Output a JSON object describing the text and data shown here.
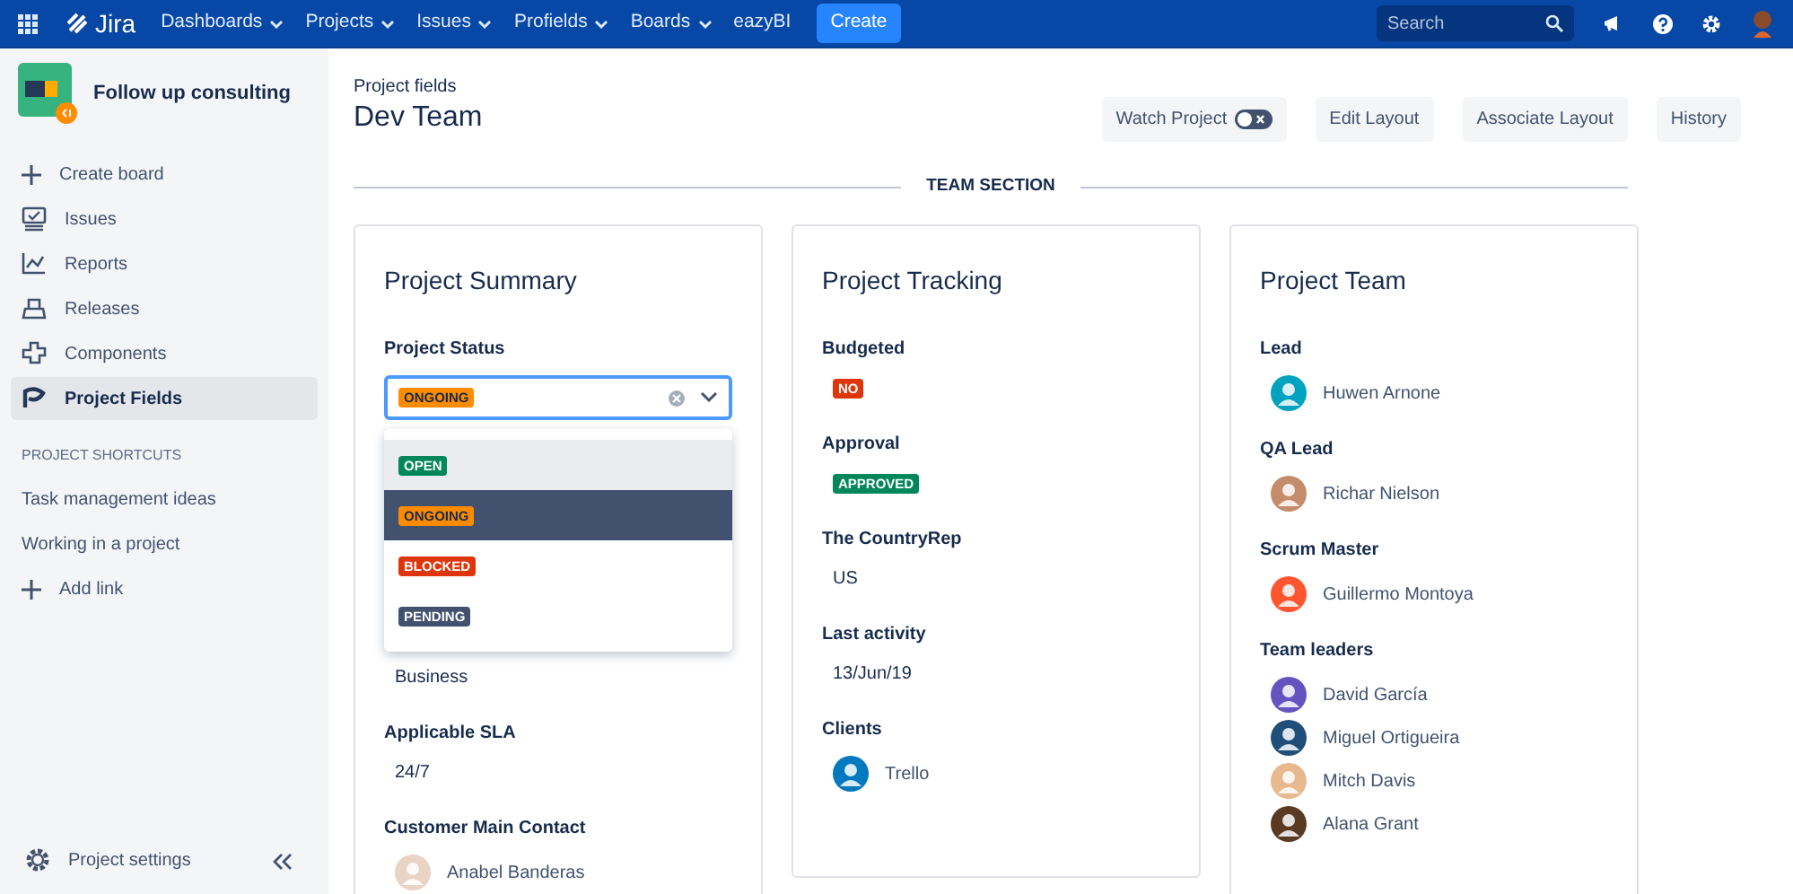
{
  "topnav": {
    "menus": [
      {
        "label": "Dashboards",
        "caret": true
      },
      {
        "label": "Projects",
        "caret": true
      },
      {
        "label": "Issues",
        "caret": true
      },
      {
        "label": "Profields",
        "caret": true
      },
      {
        "label": "Boards",
        "caret": true
      },
      {
        "label": "eazyBI",
        "caret": false
      }
    ],
    "logo": "Jira",
    "create": "Create",
    "search": {
      "placeholder": "Search"
    }
  },
  "sidebar": {
    "project": "Follow up consulting",
    "create_board": "Create board",
    "items": [
      {
        "label": "Issues",
        "selected": false
      },
      {
        "label": "Reports",
        "selected": false
      },
      {
        "label": "Releases",
        "selected": false
      },
      {
        "label": "Components",
        "selected": false
      },
      {
        "label": "Project Fields",
        "selected": true
      }
    ],
    "shortcuts_heading": "PROJECT SHORTCUTS",
    "shortcuts": [
      "Task management ideas",
      "Working in a project"
    ],
    "add_link": "Add link",
    "settings": "Project settings"
  },
  "header": {
    "breadcrumb": "Project fields",
    "title": "Dev Team",
    "watch": {
      "label": "Watch Project",
      "on": false
    },
    "buttons": [
      "Edit Layout",
      "Associate Layout",
      "History"
    ]
  },
  "section_title": "TEAM SECTION",
  "cards": [
    {
      "title": "Project Summary",
      "fields": [
        {
          "kind": "select",
          "label": "Project Status",
          "value": {
            "label": "ONGOING",
            "color": "#ff8b00"
          },
          "options": [
            {
              "label": "OPEN",
              "color": "#00875a",
              "selected": false,
              "hovered": true
            },
            {
              "label": "ONGOING",
              "color": "#ff8b00",
              "selected": true,
              "hovered": false
            },
            {
              "label": "BLOCKED",
              "color": "#de350b",
              "selected": false,
              "hovered": false
            },
            {
              "label": "PENDING",
              "color": "#42526e",
              "selected": false,
              "hovered": false
            }
          ]
        },
        {
          "kind": "text",
          "value": "Business"
        },
        {
          "kind": "text",
          "label": "Applicable SLA",
          "value": "24/7"
        },
        {
          "kind": "users",
          "label": "Customer Main Contact",
          "users": [
            {
              "name": "Anabel Banderas",
              "color": "#e9d3c4"
            }
          ]
        }
      ]
    },
    {
      "title": "Project Tracking",
      "fields": [
        {
          "kind": "lozenge",
          "label": "Budgeted",
          "value": {
            "label": "NO",
            "color": "#de350b"
          }
        },
        {
          "kind": "lozenge",
          "label": "Approval",
          "value": {
            "label": "APPROVED",
            "color": "#00875a"
          }
        },
        {
          "kind": "text",
          "label": "The CountryRep",
          "value": "US"
        },
        {
          "kind": "text",
          "label": "Last activity",
          "value": "13/Jun/19"
        },
        {
          "kind": "users",
          "label": "Clients",
          "users": [
            {
              "name": "Trello",
              "color": "#0079bf"
            }
          ]
        }
      ]
    },
    {
      "title": "Project Team",
      "fields": [
        {
          "kind": "users",
          "label": "Lead",
          "users": [
            {
              "name": "Huwen Arnone",
              "color": "#00a3bf"
            }
          ]
        },
        {
          "kind": "users",
          "label": "QA Lead",
          "users": [
            {
              "name": "Richar Nielson",
              "color": "#c58c6b"
            }
          ]
        },
        {
          "kind": "users",
          "label": "Scrum Master",
          "users": [
            {
              "name": "Guillermo Montoya",
              "color": "#ff5630"
            }
          ]
        },
        {
          "kind": "users",
          "label": "Team leaders",
          "users": [
            {
              "name": "David García",
              "color": "#6554c0"
            },
            {
              "name": "Miguel Ortigueira",
              "color": "#1f4e79"
            },
            {
              "name": "Mitch Davis",
              "color": "#e8b98f"
            },
            {
              "name": "Alana Grant",
              "color": "#5a3a22"
            }
          ]
        }
      ]
    }
  ]
}
